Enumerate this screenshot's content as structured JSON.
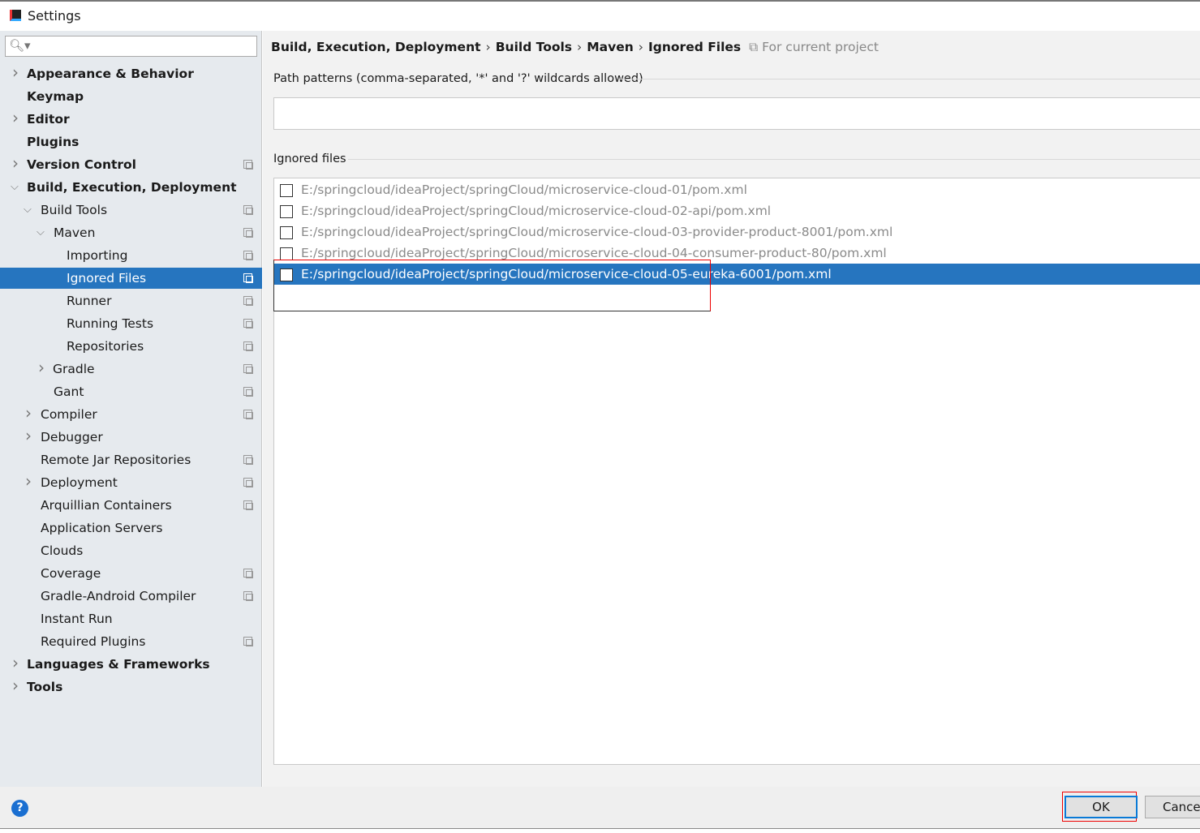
{
  "window": {
    "title": "Settings"
  },
  "search": {
    "placeholder": ""
  },
  "tree": [
    {
      "label": "Appearance & Behavior",
      "level": 0,
      "arrow": "right",
      "bold": true,
      "project": false
    },
    {
      "label": "Keymap",
      "level": 0,
      "arrow": "none",
      "bold": true,
      "project": false
    },
    {
      "label": "Editor",
      "level": 0,
      "arrow": "right",
      "bold": true,
      "project": false
    },
    {
      "label": "Plugins",
      "level": 0,
      "arrow": "none",
      "bold": true,
      "project": false
    },
    {
      "label": "Version Control",
      "level": 0,
      "arrow": "right",
      "bold": true,
      "project": true
    },
    {
      "label": "Build, Execution, Deployment",
      "level": 0,
      "arrow": "down",
      "bold": true,
      "project": false
    },
    {
      "label": "Build Tools",
      "level": 1,
      "arrow": "down",
      "project": true
    },
    {
      "label": "Maven",
      "level": 2,
      "arrow": "down",
      "project": true
    },
    {
      "label": "Importing",
      "level": 3,
      "arrow": "none",
      "project": true
    },
    {
      "label": "Ignored Files",
      "level": 3,
      "arrow": "none",
      "project": true,
      "selected": true
    },
    {
      "label": "Runner",
      "level": 3,
      "arrow": "none",
      "project": true
    },
    {
      "label": "Running Tests",
      "level": 3,
      "arrow": "none",
      "project": true
    },
    {
      "label": "Repositories",
      "level": 3,
      "arrow": "none",
      "project": true
    },
    {
      "label": "Gradle",
      "level": 2,
      "arrow": "right",
      "project": true
    },
    {
      "label": "Gant",
      "level": 2,
      "arrow": "none",
      "project": true
    },
    {
      "label": "Compiler",
      "level": 1,
      "arrow": "right",
      "project": true
    },
    {
      "label": "Debugger",
      "level": 1,
      "arrow": "right",
      "project": false
    },
    {
      "label": "Remote Jar Repositories",
      "level": 1,
      "arrow": "none",
      "project": true
    },
    {
      "label": "Deployment",
      "level": 1,
      "arrow": "right",
      "project": true
    },
    {
      "label": "Arquillian Containers",
      "level": 1,
      "arrow": "none",
      "project": true
    },
    {
      "label": "Application Servers",
      "level": 1,
      "arrow": "none",
      "project": false
    },
    {
      "label": "Clouds",
      "level": 1,
      "arrow": "none",
      "project": false
    },
    {
      "label": "Coverage",
      "level": 1,
      "arrow": "none",
      "project": true
    },
    {
      "label": "Gradle-Android Compiler",
      "level": 1,
      "arrow": "none",
      "project": true
    },
    {
      "label": "Instant Run",
      "level": 1,
      "arrow": "none",
      "project": false
    },
    {
      "label": "Required Plugins",
      "level": 1,
      "arrow": "none",
      "project": true
    },
    {
      "label": "Languages & Frameworks",
      "level": 0,
      "arrow": "right",
      "bold": true,
      "project": false
    },
    {
      "label": "Tools",
      "level": 0,
      "arrow": "right",
      "bold": true,
      "project": false
    }
  ],
  "breadcrumb": [
    "Build, Execution, Deployment",
    "Build Tools",
    "Maven",
    "Ignored Files"
  ],
  "breadcrumb_sep": "›",
  "scope": "For current project",
  "path_patterns": {
    "label": "Path patterns (comma-separated, '*' and '?' wildcards allowed)",
    "value": ""
  },
  "ignored_files": {
    "label": "Ignored files",
    "items": [
      {
        "path": "E:/springcloud/ideaProject/springCloud/microservice-cloud-01/pom.xml",
        "checked": false
      },
      {
        "path": "E:/springcloud/ideaProject/springCloud/microservice-cloud-02-api/pom.xml",
        "checked": false
      },
      {
        "path": "E:/springcloud/ideaProject/springCloud/microservice-cloud-03-provider-product-8001/pom.xml",
        "checked": false
      },
      {
        "path": "E:/springcloud/ideaProject/springCloud/microservice-cloud-04-consumer-product-80/pom.xml",
        "checked": false
      },
      {
        "path": "E:/springcloud/ideaProject/springCloud/microservice-cloud-05-eureka-6001/pom.xml",
        "checked": false,
        "selected": true
      }
    ]
  },
  "footer": {
    "help": "?",
    "ok": "OK",
    "cancel": "Cancel"
  },
  "colors": {
    "selection": "#2675bf",
    "highlight": "#e00000"
  }
}
